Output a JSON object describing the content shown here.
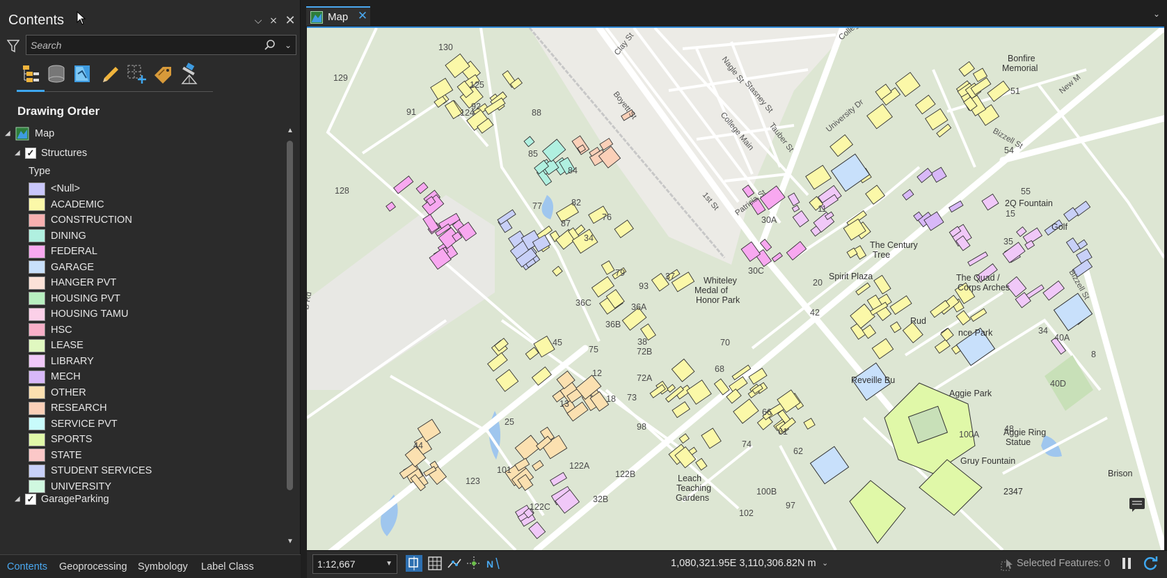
{
  "pane": {
    "title": "Contents",
    "search_placeholder": "Search",
    "section_title": "Drawing Order",
    "map_layer": "Map",
    "structures_layer": "Structures",
    "type_heading": "Type",
    "garage_layer": "GarageParking",
    "legend": [
      {
        "label": "<Null>",
        "color": "#c9c7fb"
      },
      {
        "label": "ACADEMIC",
        "color": "#fbf8a8"
      },
      {
        "label": "CONSTRUCTION",
        "color": "#f8b0b0"
      },
      {
        "label": "DINING",
        "color": "#b0f0e0"
      },
      {
        "label": "FEDERAL",
        "color": "#f8a8f0"
      },
      {
        "label": "GARAGE",
        "color": "#c8e0fb"
      },
      {
        "label": "HANGER PVT",
        "color": "#fbe2d8"
      },
      {
        "label": "HOUSING PVT",
        "color": "#b8f0c0"
      },
      {
        "label": "HOUSING TAMU",
        "color": "#fbd0e8"
      },
      {
        "label": "HSC",
        "color": "#f8b0c8"
      },
      {
        "label": "LEASE",
        "color": "#e0f8c0"
      },
      {
        "label": "LIBRARY",
        "color": "#f0c8f8"
      },
      {
        "label": "MECH",
        "color": "#d8b8f8"
      },
      {
        "label": "OTHER",
        "color": "#fbe0b0"
      },
      {
        "label": "RESEARCH",
        "color": "#fbd0b8"
      },
      {
        "label": "SERVICE PVT",
        "color": "#c8fbfb"
      },
      {
        "label": "SPORTS",
        "color": "#e0f8a8"
      },
      {
        "label": "STATE",
        "color": "#fbc8c8"
      },
      {
        "label": "STUDENT SERVICES",
        "color": "#c8d0f8"
      },
      {
        "label": "UNIVERSITY",
        "color": "#d0f8e0"
      }
    ],
    "bottom_tabs": [
      "Contents",
      "Geoprocessing",
      "Symbology",
      "Label Class"
    ]
  },
  "map_tab": {
    "label": "Map"
  },
  "status": {
    "scale": "1:12,667",
    "coordinates": "1,080,321.95E 3,110,306.82N m",
    "selected_features": "Selected Features: 0"
  },
  "map_labels": {
    "numbers": [
      "130",
      "129",
      "125",
      "124",
      "91",
      "92",
      "88",
      "85",
      "84",
      "77",
      "82",
      "87",
      "76",
      "128",
      "34",
      "79",
      "93",
      "37",
      "36C",
      "36A",
      "36B",
      "38",
      "45",
      "75",
      "12",
      "72B",
      "72A",
      "73",
      "18",
      "98",
      "13",
      "25",
      "44",
      "101",
      "123",
      "122A",
      "122B",
      "122C",
      "32B",
      "70",
      "68",
      "66",
      "61",
      "74",
      "62",
      "48",
      "100A",
      "100B",
      "102",
      "97",
      "42",
      "20",
      "30A",
      "30C",
      "11",
      "51",
      "54",
      "55",
      "15",
      "35",
      "34",
      "40A",
      "8",
      "40D"
    ],
    "streets": [
      "Clay St",
      "Nagle St",
      "College Ave",
      "Boyett St",
      "Stasney St",
      "College Main",
      "Tauber St",
      "1st St",
      "Patricia St",
      "University Dr",
      "Bizzell St",
      "New M",
      "Bizzell St",
      "B Rd"
    ],
    "places": [
      "Bonfire",
      "Memorial",
      "Golf",
      "Whiteley",
      "Medal of",
      "Honor Park",
      "Spirit Plaza",
      "The Quad /",
      "Corps Arches",
      "Aggie Park",
      "Aggie Ring",
      "Statue",
      "Gruy Fountain",
      "Leach",
      "Teaching",
      "Gardens",
      "Reveille Bu",
      "Rud",
      "nce Park",
      "2Q Fountain",
      "The Century",
      "Tree",
      "Brison",
      "2347"
    ]
  }
}
